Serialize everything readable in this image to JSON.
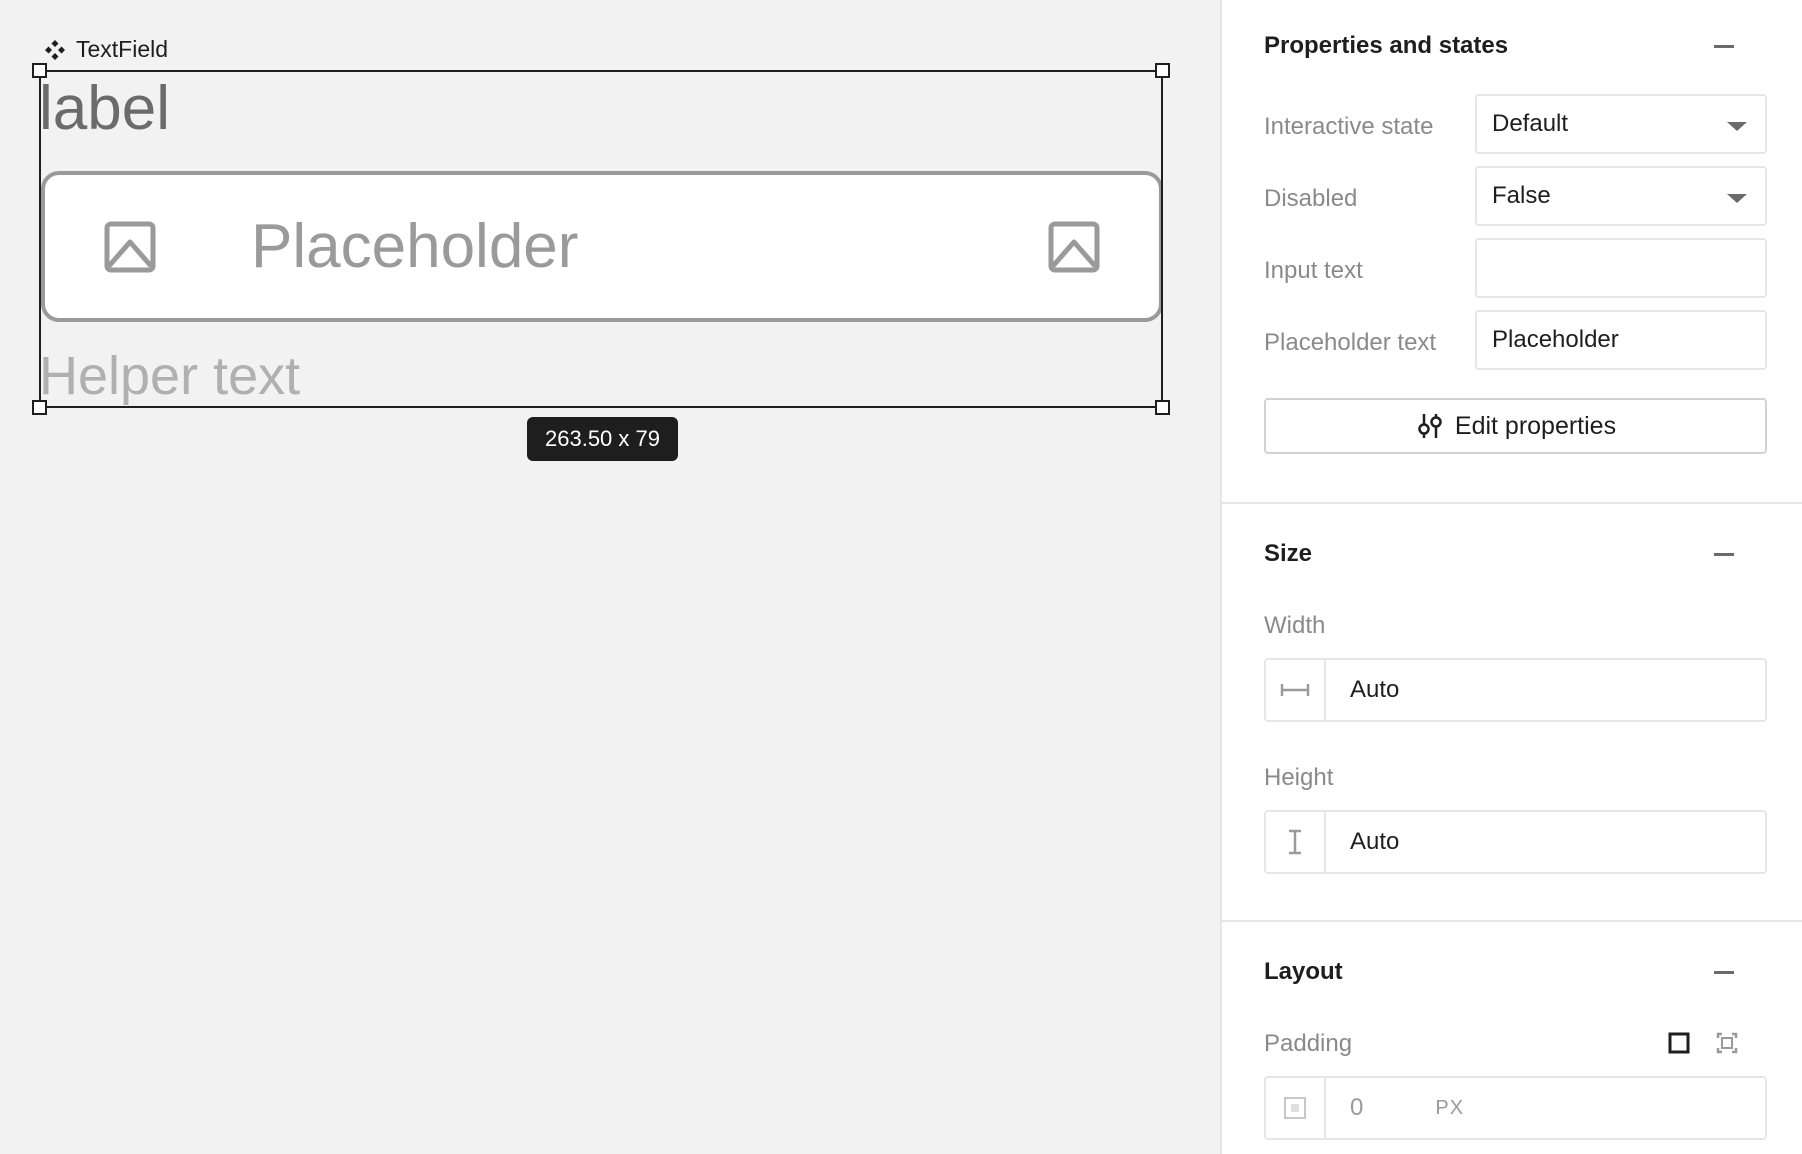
{
  "canvas": {
    "component_name": "TextField",
    "label": "label",
    "placeholder": "Placeholder",
    "helper_text": "Helper text",
    "dimensions": "263.50 x 79",
    "icons": {
      "component": "component-icon",
      "leading": "image-icon",
      "trailing": "image-icon"
    }
  },
  "panel": {
    "properties": {
      "title": "Properties and states",
      "rows": [
        {
          "label": "Interactive state",
          "value": "Default",
          "type": "select"
        },
        {
          "label": "Disabled",
          "value": "False",
          "type": "select"
        },
        {
          "label": "Input text",
          "value": "",
          "type": "text"
        },
        {
          "label": "Placeholder text",
          "value": "Placeholder",
          "type": "text"
        }
      ],
      "edit_button": "Edit properties"
    },
    "size": {
      "title": "Size",
      "width_label": "Width",
      "width_value": "Auto",
      "height_label": "Height",
      "height_value": "Auto"
    },
    "layout": {
      "title": "Layout",
      "padding_label": "Padding",
      "padding_value": "0",
      "padding_unit": "PX"
    }
  }
}
